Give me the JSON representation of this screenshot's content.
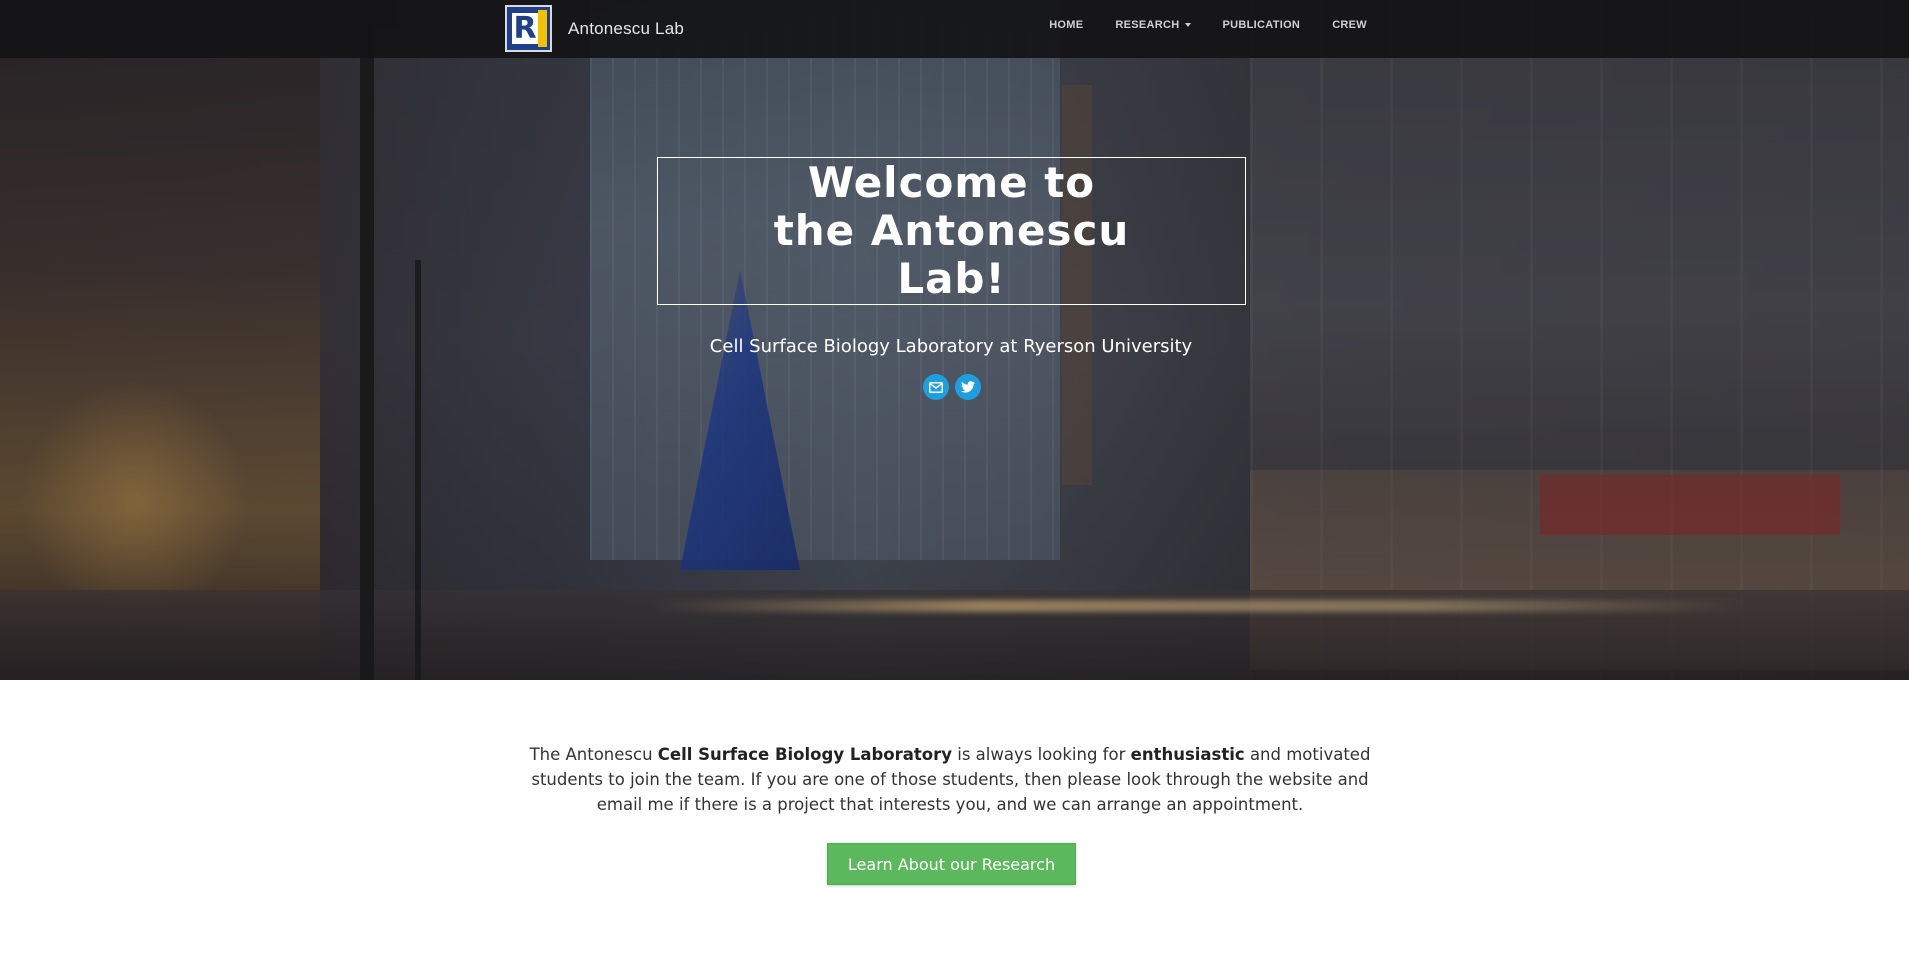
{
  "navbar": {
    "brand_name": "Antonescu Lab",
    "logo_letter": "R",
    "links": [
      {
        "label": "HOME"
      },
      {
        "label": "RESEARCH"
      },
      {
        "label": "PUBLICATION"
      },
      {
        "label": "CREW"
      }
    ]
  },
  "hero": {
    "title": "Welcome to the Antonescu Lab!",
    "subtitle": "Cell Surface Biology Laboratory at Ryerson University",
    "social": [
      {
        "icon": "envelope-icon"
      },
      {
        "icon": "twitter-icon"
      }
    ]
  },
  "intro": {
    "part1": "The Antonescu ",
    "bold1": "Cell Surface Biology Laboratory",
    "part2": " is always looking for ",
    "bold2": "enthusiastic",
    "part3": " and motivated students to join the team. If you are one of those students, then please look through the website and email me if there is a project that interests you, and we can arrange an appointment."
  },
  "cta": {
    "label": "Learn About our Research"
  },
  "colors": {
    "navbar_bg": "#141416",
    "social_blue": "#1e9fe0",
    "cta_green": "#5cb85c",
    "logo_blue": "#1f3f8a",
    "logo_yellow": "#f2c200"
  }
}
